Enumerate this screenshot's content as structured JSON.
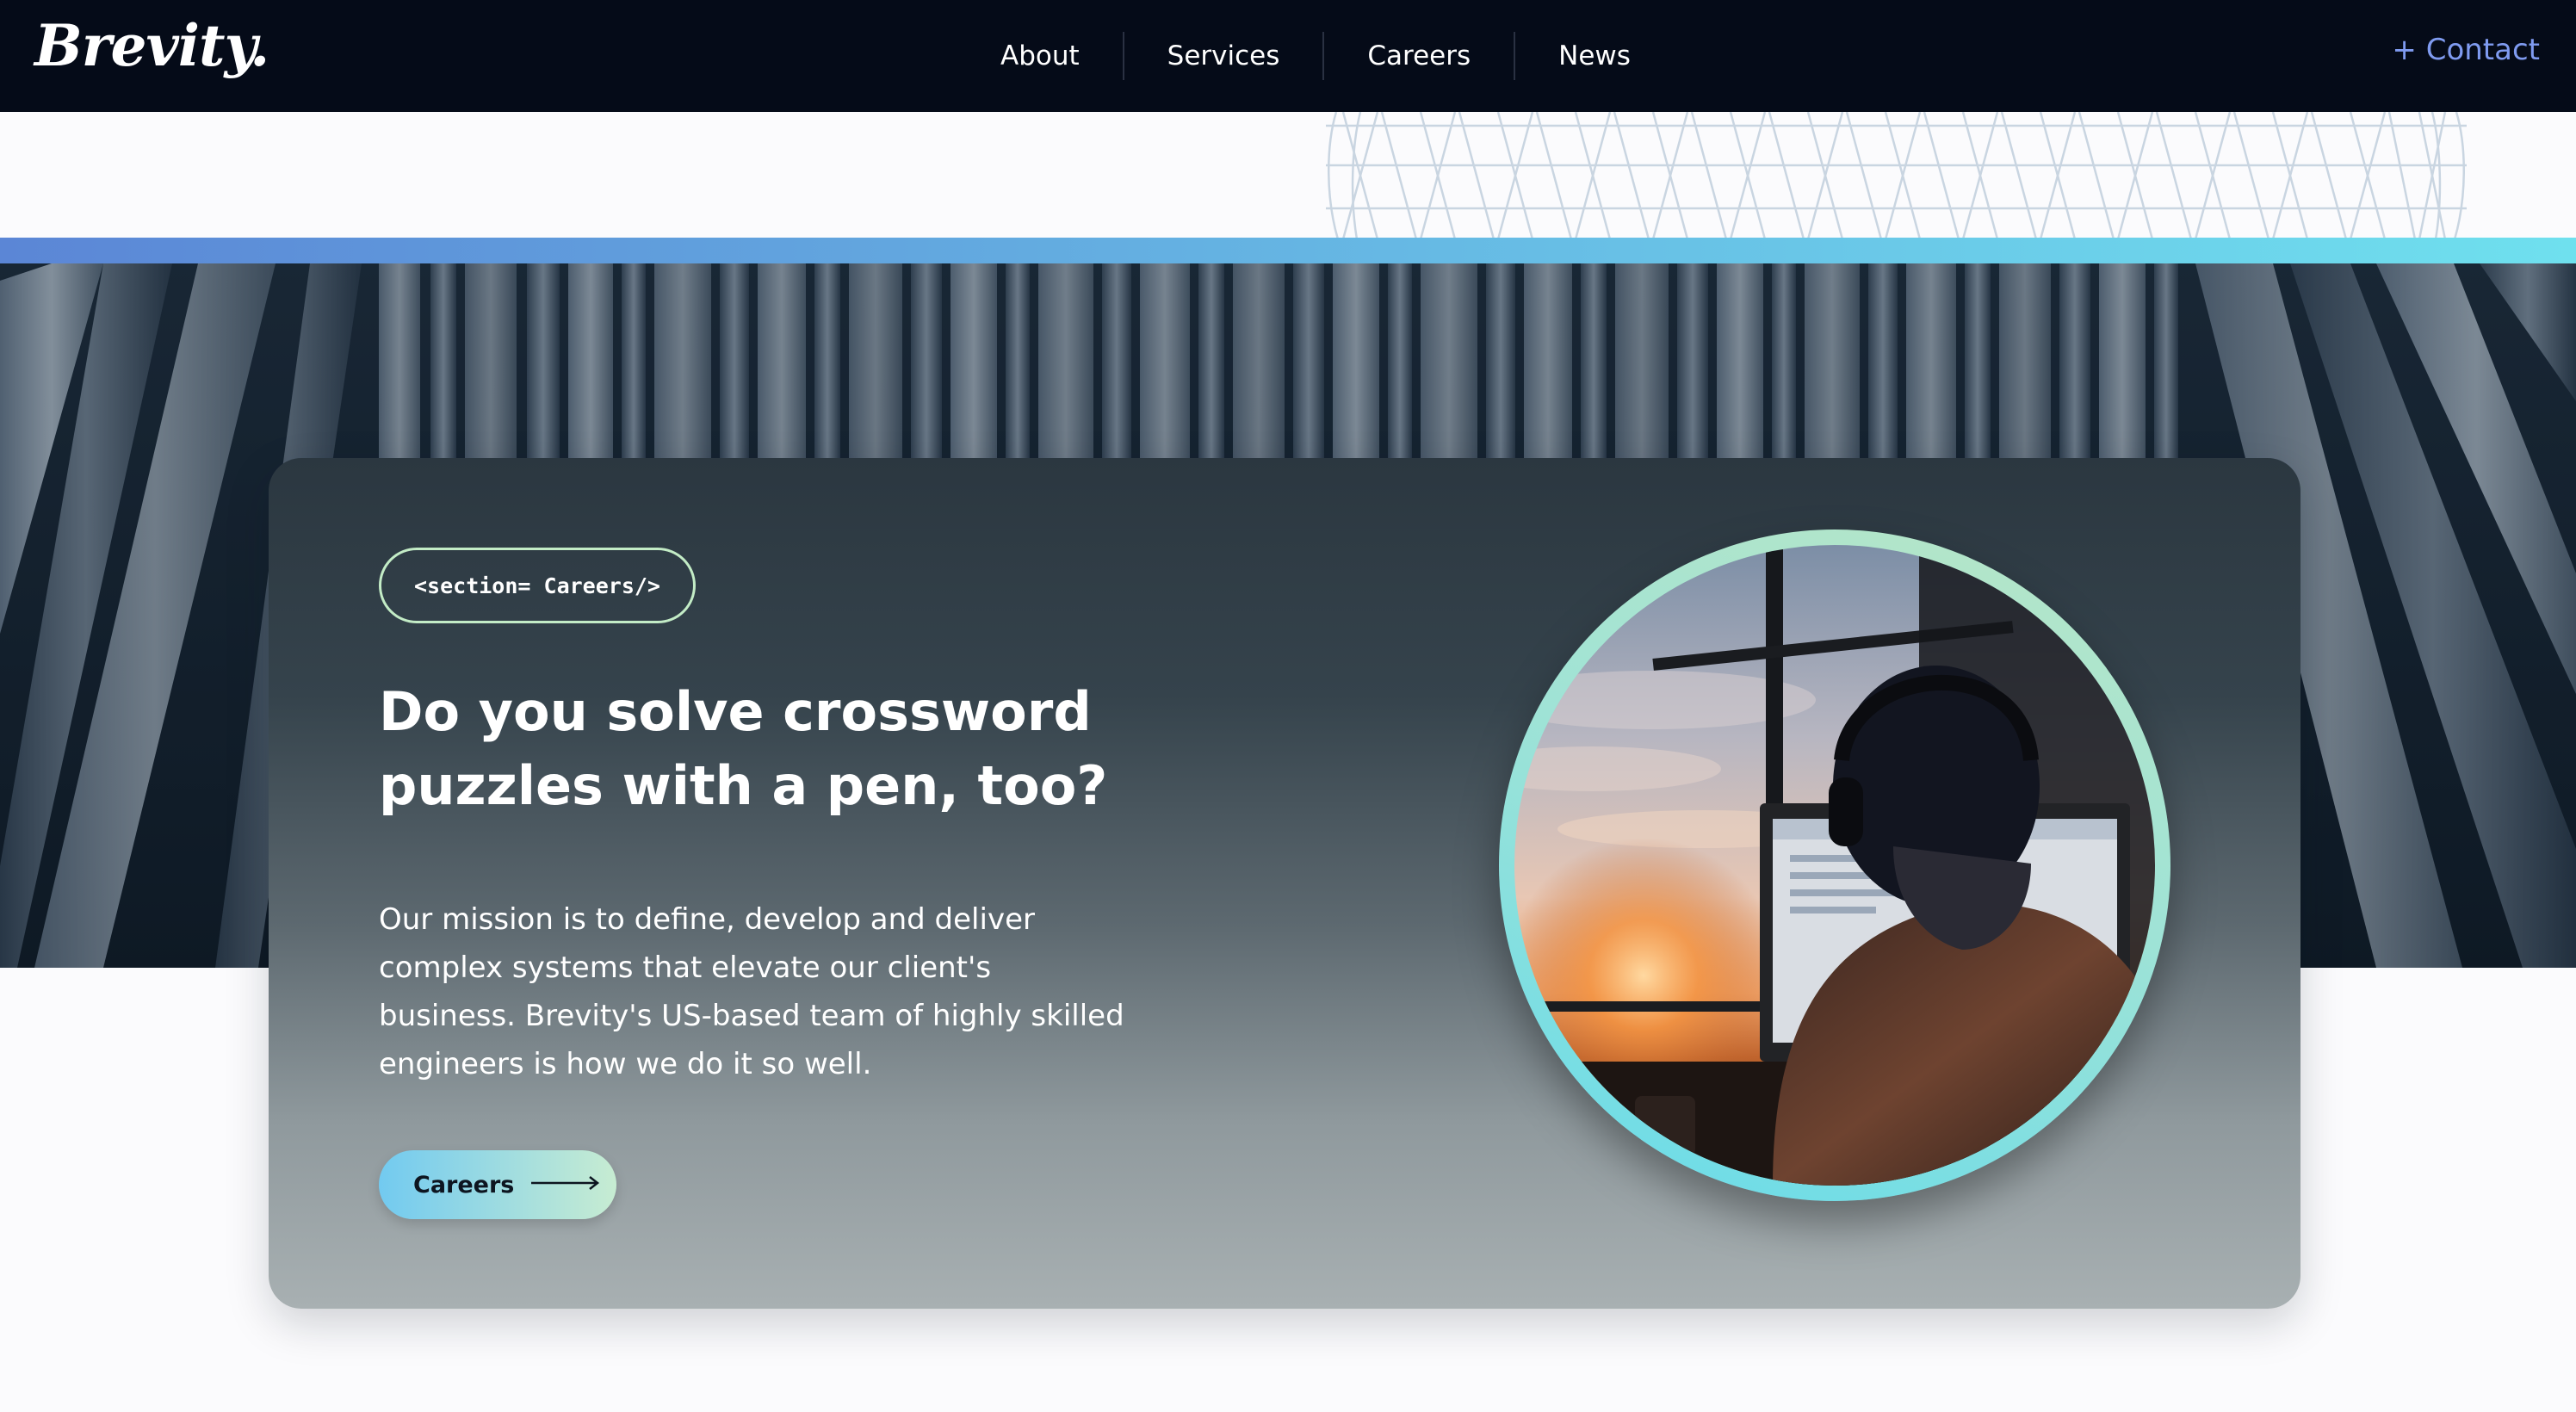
{
  "nav": {
    "logo": "Brevity.",
    "links": [
      "About",
      "Services",
      "Careers",
      "News"
    ],
    "contact": "+ Contact"
  },
  "hero": {
    "tag": "<section= Careers/>",
    "headline": "Do you solve crossword puzzles with a pen, too?",
    "mission": "Our mission is to define, develop and deliver complex systems that elevate our client's business. Brevity's US-based team of highly skilled engineers is how we do it so well.",
    "cta_label": "Careers",
    "cta_icon": "arrow-right-icon",
    "image_icon": "person-at-computer-photo"
  },
  "colors": {
    "nav_bg": "#050b18",
    "contact": "#7f9bf0",
    "stripe_start": "#5b86d6",
    "stripe_end": "#6fe0ee",
    "tag_border": "#c3ecc6",
    "cta_start": "#72caf0",
    "cta_end": "#c7ecd2"
  }
}
